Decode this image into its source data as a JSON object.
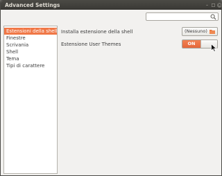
{
  "window": {
    "title": "Advanced Settings"
  },
  "toolbar": {
    "search_value": "",
    "search_icon": "search-icon"
  },
  "sidebar": {
    "items": [
      {
        "label": "Estensioni della shell",
        "selected": true
      },
      {
        "label": "Finestre",
        "selected": false
      },
      {
        "label": "Scrivania",
        "selected": false
      },
      {
        "label": "Shell",
        "selected": false
      },
      {
        "label": "Tema",
        "selected": false
      },
      {
        "label": "Tipi di carattere",
        "selected": false
      }
    ]
  },
  "main": {
    "install_extension": {
      "label": "Installa estensione della shell",
      "button_value": "(Nessuno)",
      "icon": "folder-icon"
    },
    "user_themes": {
      "label": "Estensione User Themes",
      "switch_value": "ON"
    }
  },
  "colors": {
    "accent": "#f07746",
    "titlebar": "#3c3b37",
    "window_bg": "#f2f1ef"
  }
}
